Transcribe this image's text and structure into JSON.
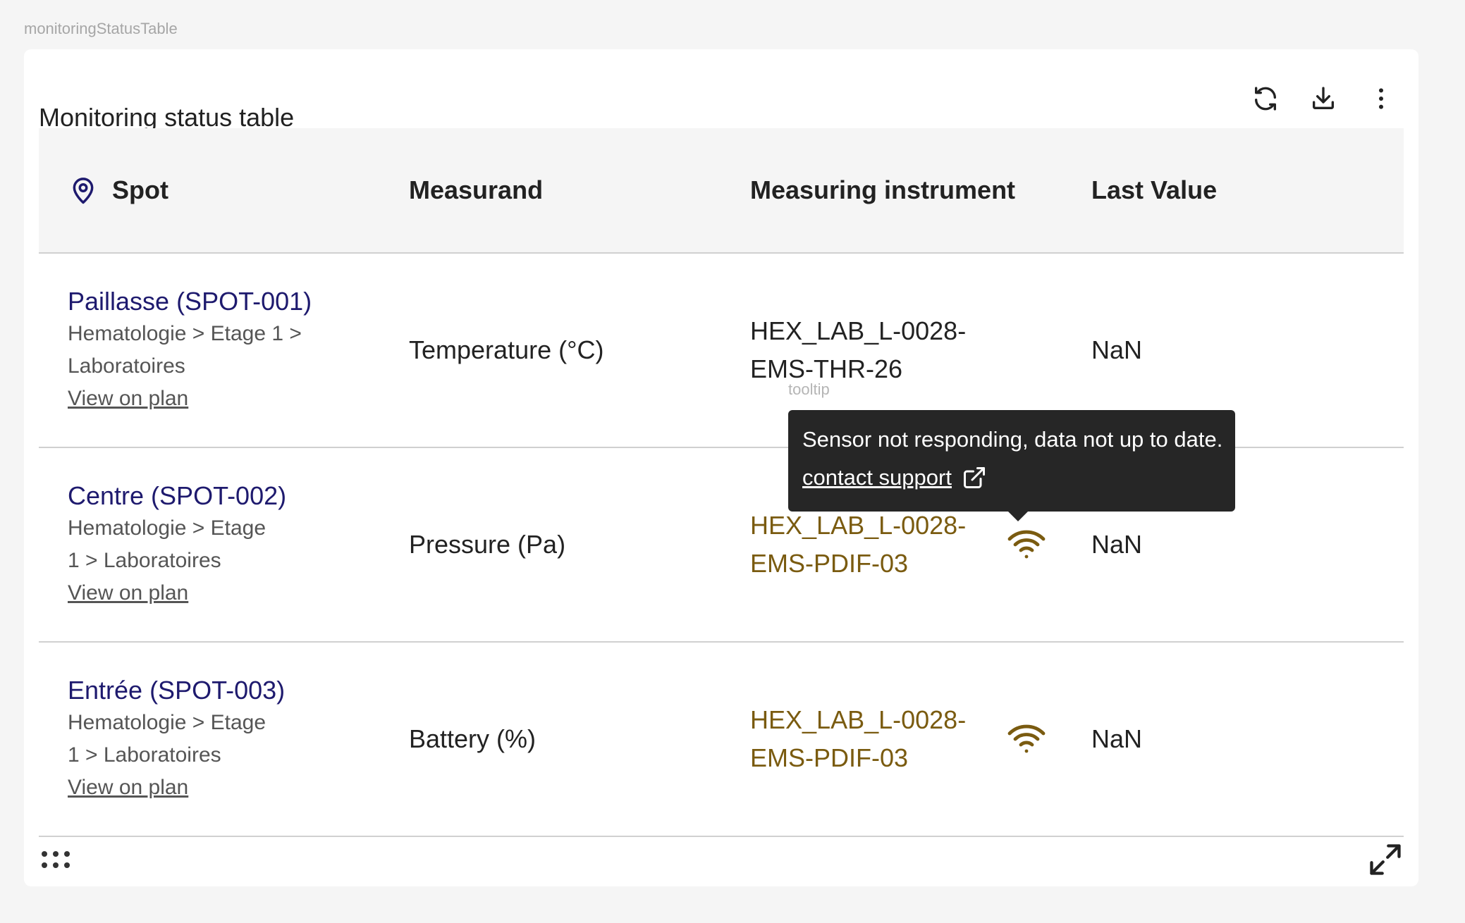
{
  "component_label": "monitoringStatusTable",
  "card": {
    "title": "Monitoring status table",
    "actions": [
      "refresh-icon",
      "download-icon",
      "more-vertical-icon"
    ]
  },
  "table": {
    "columns": {
      "spot": "Spot",
      "measurand": "Measurand",
      "instrument": "Measuring instrument",
      "last_value": "Last Value"
    },
    "rows": [
      {
        "spot_name": "Paillasse (SPOT-001)",
        "spot_path": "Hematologie > Etage 1 > Laboratoires",
        "view_on_plan": "View on plan",
        "measurand": "Temperature (°C)",
        "instrument": "HEX_LAB_L-0028-EMS-THR-26",
        "instrument_status": "ok",
        "last_value": "NaN"
      },
      {
        "spot_name": "Centre (SPOT-002)",
        "spot_path": "Hematologie > Etage 1 > Laboratoires",
        "view_on_plan": "View on plan",
        "measurand": "Pressure (Pa)",
        "instrument": "HEX_LAB_L-0028-EMS-PDIF-03",
        "instrument_status": "warning",
        "last_value": "NaN"
      },
      {
        "spot_name": "Entrée (SPOT-003)",
        "spot_path": "Hematologie > Etage 1 > Laboratoires",
        "view_on_plan": "View on plan",
        "measurand": "Battery (%)",
        "instrument": "HEX_LAB_L-0028-EMS-PDIF-03",
        "instrument_status": "warning",
        "last_value": "NaN"
      }
    ]
  },
  "tooltip": {
    "label": "tooltip",
    "message": "Sensor not responding, data not up to date.",
    "link_text": "contact support"
  },
  "colors": {
    "spot_link": "#1e1a6e",
    "warning": "#7a5b10",
    "tooltip_bg": "#262626",
    "header_bg": "#f5f5f5"
  }
}
